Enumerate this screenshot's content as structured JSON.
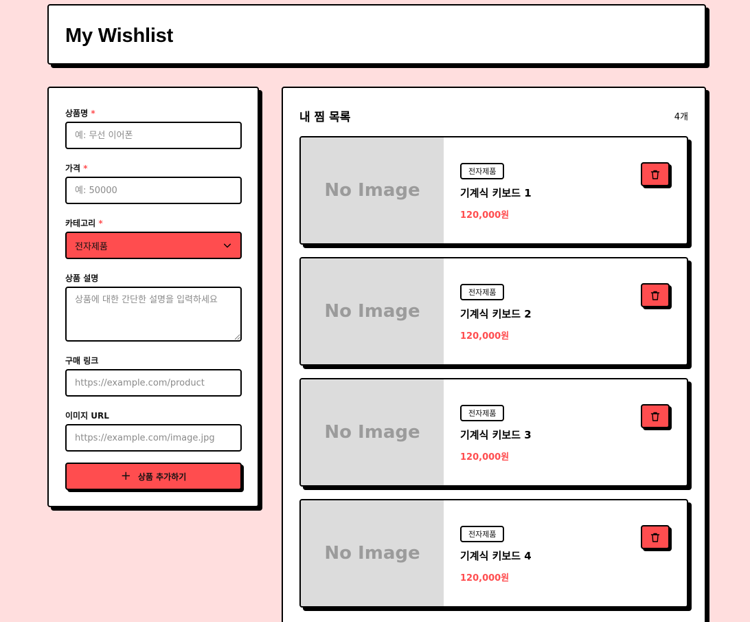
{
  "header": {
    "title": "My Wishlist"
  },
  "form": {
    "fields": {
      "name": {
        "label": "상품명",
        "required": "*",
        "placeholder": "예: 무선 이어폰"
      },
      "price": {
        "label": "가격",
        "required": "*",
        "placeholder": "예: 50000"
      },
      "category": {
        "label": "카테고리",
        "required": "*",
        "value": "전자제품"
      },
      "description": {
        "label": "상품 설명",
        "placeholder": "상품에 대한 간단한 설명을 입력하세요"
      },
      "link": {
        "label": "구매 링크",
        "placeholder": "https://example.com/product"
      },
      "image": {
        "label": "이미지 URL",
        "placeholder": "https://example.com/image.jpg"
      }
    },
    "submit_label": "상품 추가하기"
  },
  "list": {
    "title": "내 찜 목록",
    "count": "4개",
    "no_image_text": "No Image",
    "items": [
      {
        "category": "전자제품",
        "name": "기계식 키보드 1",
        "price": "120,000원"
      },
      {
        "category": "전자제품",
        "name": "기계식 키보드 2",
        "price": "120,000원"
      },
      {
        "category": "전자제품",
        "name": "기계식 키보드 3",
        "price": "120,000원"
      },
      {
        "category": "전자제품",
        "name": "기계식 키보드 4",
        "price": "120,000원"
      }
    ]
  },
  "colors": {
    "background": "#ffdede",
    "accent": "#ff4d4f",
    "border": "#000000",
    "placeholder_bg": "#dcdcdc"
  },
  "icons": {
    "add": "plus-icon",
    "delete": "trash-icon",
    "select": "chevron-down-icon"
  }
}
